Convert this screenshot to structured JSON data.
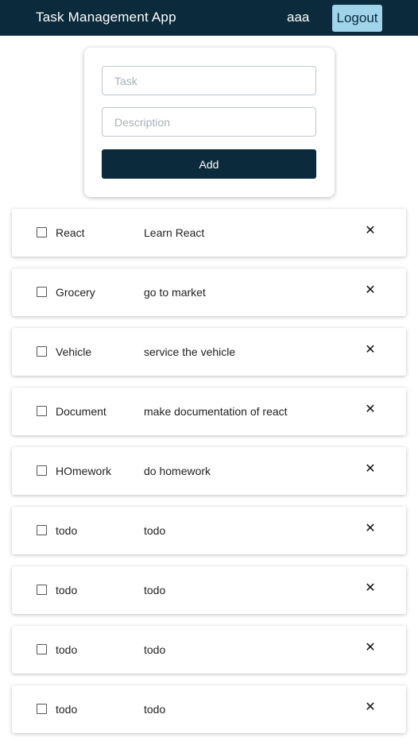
{
  "navbar": {
    "title": "Task Management App",
    "username": "aaa",
    "logout_label": "Logout"
  },
  "form": {
    "task_placeholder": "Task",
    "task_value": "",
    "description_placeholder": "Description",
    "description_value": "",
    "add_label": "Add"
  },
  "tasks": [
    {
      "name": "React",
      "description": "Learn React",
      "completed": false,
      "delete_icon": "✕"
    },
    {
      "name": "Grocery",
      "description": "go to market",
      "completed": false,
      "delete_icon": "✕"
    },
    {
      "name": "Vehicle",
      "description": "service the vehicle",
      "completed": false,
      "delete_icon": "✕"
    },
    {
      "name": "Document",
      "description": "make documentation of react",
      "completed": false,
      "delete_icon": "✕"
    },
    {
      "name": "HOmework",
      "description": "do homework",
      "completed": false,
      "delete_icon": "✕"
    },
    {
      "name": "todo",
      "description": "todo",
      "completed": false,
      "delete_icon": "✕"
    },
    {
      "name": "todo",
      "description": "todo",
      "completed": false,
      "delete_icon": "✕"
    },
    {
      "name": "todo",
      "description": "todo",
      "completed": false,
      "delete_icon": "✕"
    },
    {
      "name": "todo",
      "description": "todo",
      "completed": false,
      "delete_icon": "✕"
    }
  ],
  "colors": {
    "primary": "#0b2a3b",
    "logout_bg": "#9fd4ea"
  }
}
